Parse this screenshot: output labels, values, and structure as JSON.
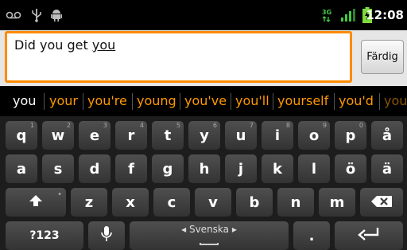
{
  "status": {
    "time": "12:08",
    "icons": [
      "voicemail-icon",
      "usb-icon",
      "android-debug-icon",
      "data-3g-icon",
      "signal-icon",
      "battery-charging-icon"
    ]
  },
  "input": {
    "text_before": "Did you get ",
    "text_composing": "you",
    "done_label": "Färdig"
  },
  "suggestions": [
    "you",
    "your",
    "you're",
    "young",
    "you've",
    "you'll",
    "yourself",
    "you'd",
    "you"
  ],
  "keyboard": {
    "row1": [
      {
        "label": "q",
        "hint": "1"
      },
      {
        "label": "w",
        "hint": "2"
      },
      {
        "label": "e",
        "hint": "3"
      },
      {
        "label": "r",
        "hint": "4"
      },
      {
        "label": "t",
        "hint": "5"
      },
      {
        "label": "y",
        "hint": "6"
      },
      {
        "label": "u",
        "hint": "7"
      },
      {
        "label": "i",
        "hint": "8"
      },
      {
        "label": "o",
        "hint": "9"
      },
      {
        "label": "p",
        "hint": "0"
      },
      {
        "label": "å",
        "hint": ""
      }
    ],
    "row2": [
      "a",
      "s",
      "d",
      "f",
      "g",
      "h",
      "j",
      "k",
      "l",
      "ö",
      "ä"
    ],
    "row3": [
      "z",
      "x",
      "c",
      "v",
      "b",
      "n",
      "m"
    ],
    "symbols_label": "?123",
    "language_label": "◂ Svenska ▸",
    "period_label": "."
  }
}
